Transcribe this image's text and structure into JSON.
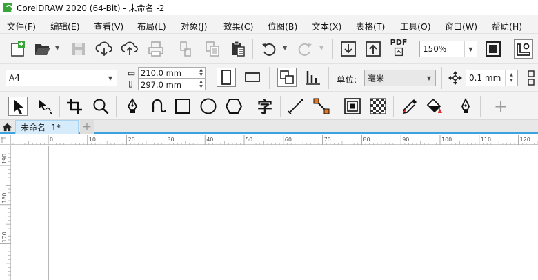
{
  "app": {
    "title": "CorelDRAW 2020 (64-Bit) - 未命名 -2"
  },
  "menu": [
    {
      "label": "文件(F)"
    },
    {
      "label": "编辑(E)"
    },
    {
      "label": "查看(V)"
    },
    {
      "label": "布局(L)"
    },
    {
      "label": "对象(J)"
    },
    {
      "label": "效果(C)"
    },
    {
      "label": "位图(B)"
    },
    {
      "label": "文本(X)"
    },
    {
      "label": "表格(T)"
    },
    {
      "label": "工具(O)"
    },
    {
      "label": "窗口(W)"
    },
    {
      "label": "帮助(H)"
    }
  ],
  "standard_toolbar": {
    "zoom_value": "150%",
    "pdf_label": "PDF",
    "icons": [
      "new-document-icon",
      "open-icon",
      "save-icon",
      "cloud-download-icon",
      "cloud-upload-icon",
      "print-icon",
      "cut-icon",
      "copy-icon",
      "paste-icon",
      "undo-icon",
      "redo-icon",
      "import-icon",
      "export-icon",
      "publish-pdf-icon",
      "full-screen-icon",
      "options-icon"
    ]
  },
  "property_bar": {
    "page_size": "A4",
    "width": "210.0 mm",
    "height": "297.0 mm",
    "units_label": "单位:",
    "units_value": "毫米",
    "nudge_value": "0.1 mm"
  },
  "toolbox": {
    "tools": [
      "pick-tool-icon",
      "freehand-pick-icon",
      "crop-tool-icon",
      "zoom-tool-icon",
      "pen-tool-icon",
      "artistic-media-icon",
      "rectangle-tool-icon",
      "ellipse-tool-icon",
      "polygon-tool-icon",
      "text-tool-icon",
      "parallel-dimension-icon",
      "connector-tool-icon",
      "contour-tool-icon",
      "transparency-tool-icon",
      "eyedropper-tool-icon",
      "interactive-fill-icon",
      "smart-fill-icon",
      "add-tool-icon"
    ],
    "text_tool_glyph": "字"
  },
  "document_tab": {
    "label": "未命名 -1*",
    "add_label": "+"
  },
  "ruler": {
    "units": "mm",
    "h_ticks": [
      "0",
      "10",
      "20",
      "30",
      "40",
      "50",
      "60",
      "70",
      "80",
      "90",
      "100",
      "110",
      "120"
    ],
    "v_ticks": [
      "190",
      "180",
      "170"
    ]
  },
  "colors": {
    "accent": "#3aa3e0",
    "logo_green": "#3aa33a",
    "toolbar_bg": "#f3f3f3"
  }
}
